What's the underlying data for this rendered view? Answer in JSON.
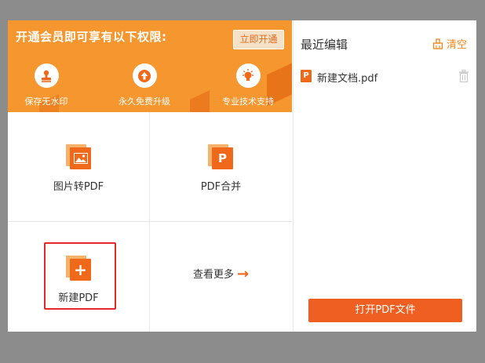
{
  "banner": {
    "title": "开通会员即可享有以下权限:",
    "activate_label": "立即开通",
    "perks": [
      {
        "label": "保存无水印",
        "icon": "stamp-icon"
      },
      {
        "label": "永久免费升级",
        "icon": "upgrade-arrow-icon"
      },
      {
        "label": "专业技术支持",
        "icon": "lightbulb-icon"
      }
    ]
  },
  "tools": {
    "image_to_pdf": {
      "label": "图片转PDF",
      "icon": "image-icon"
    },
    "pdf_merge": {
      "label": "PDF合并",
      "glyph": "P",
      "icon": "pdf-icon"
    },
    "new_pdf": {
      "label": "新建PDF",
      "glyph": "+",
      "icon": "plus-icon"
    },
    "more": {
      "label": "查看更多",
      "arrow": "→"
    }
  },
  "recent": {
    "title": "最近编辑",
    "clear_label": "清空",
    "files": [
      {
        "name": "新建文档.pdf",
        "icon_glyph": "P"
      }
    ],
    "open_button": "打开PDF文件"
  },
  "colors": {
    "banner_bg": "#f5962f",
    "accent": "#f0681a",
    "button": "#ef5f22",
    "selection": "#e02a2a"
  }
}
